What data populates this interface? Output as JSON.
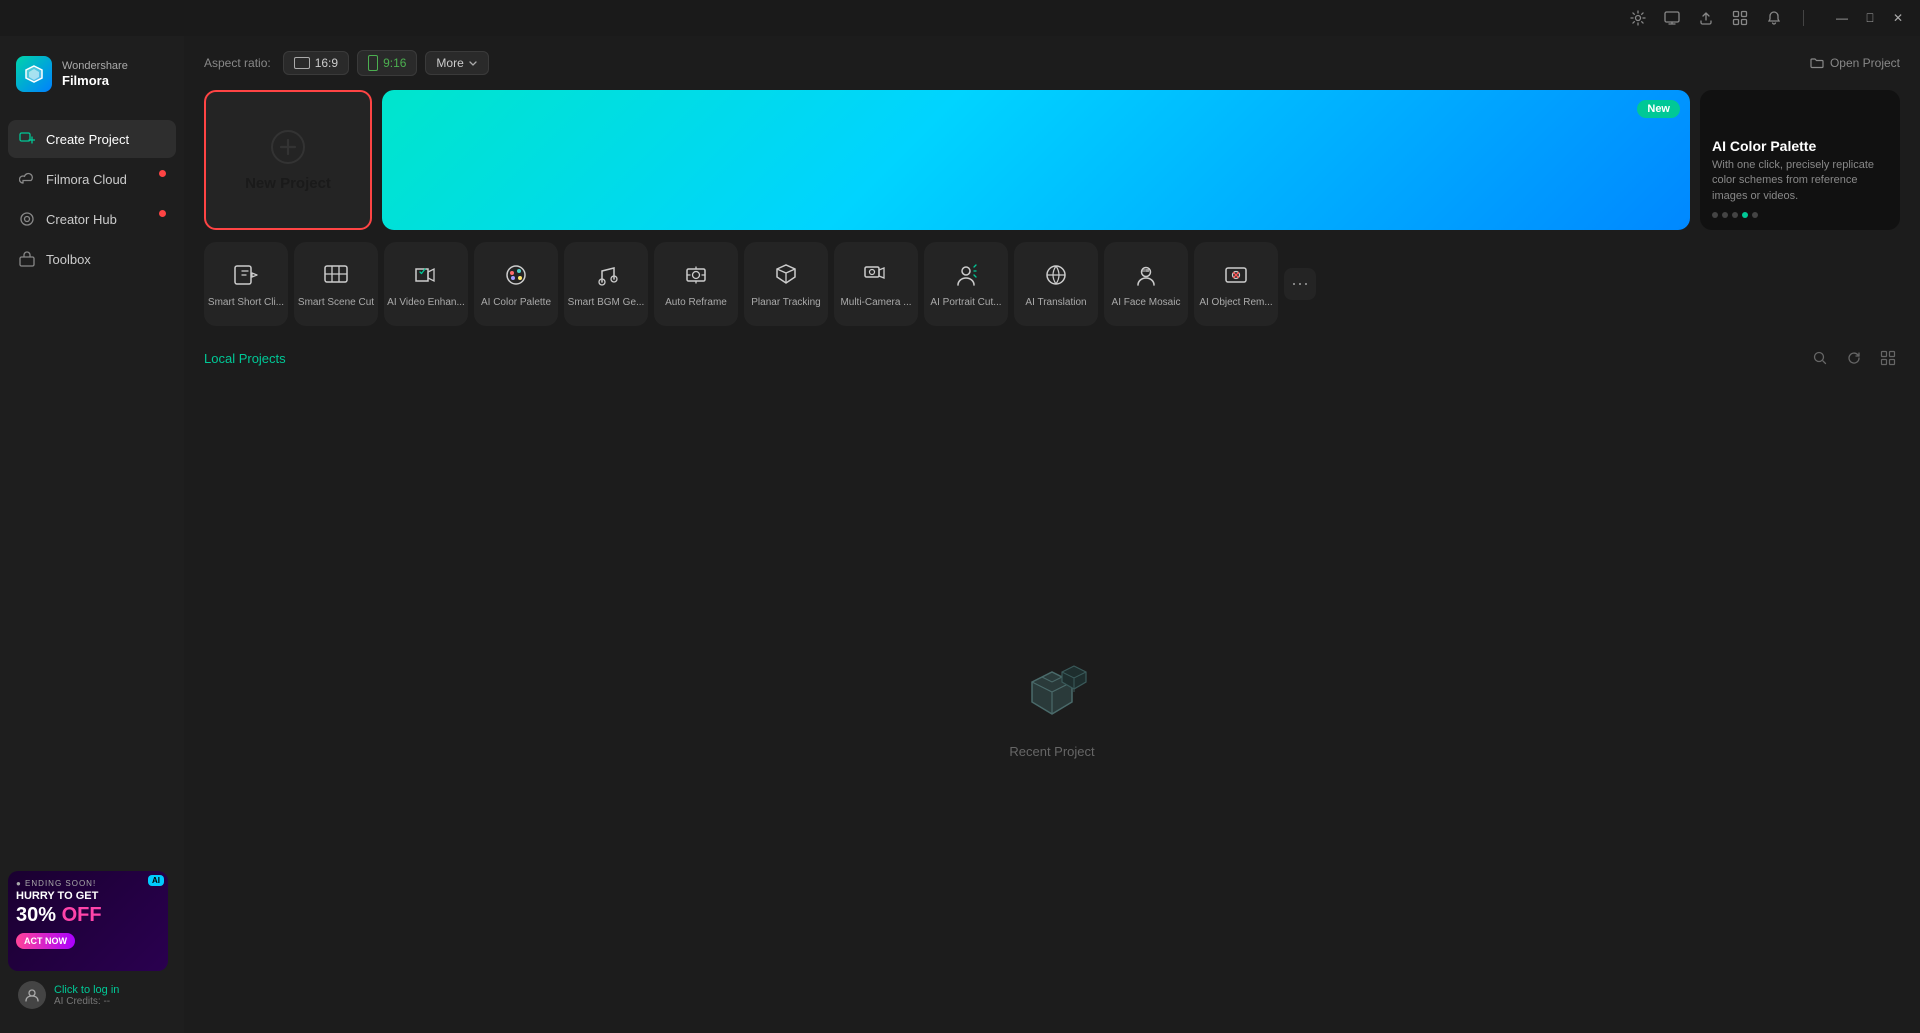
{
  "titlebar": {
    "icons": [
      "settings-icon",
      "monitor-icon",
      "upload-icon",
      "grid-icon",
      "bell-icon"
    ],
    "window_controls": [
      "minimize",
      "maximize",
      "close"
    ]
  },
  "sidebar": {
    "logo": {
      "brand": "Wondershare",
      "product": "Filmora"
    },
    "nav_items": [
      {
        "id": "create-project",
        "label": "Create Project",
        "active": true
      },
      {
        "id": "filmora-cloud",
        "label": "Filmora Cloud",
        "badge": true
      },
      {
        "id": "creator-hub",
        "label": "Creator Hub",
        "badge": true
      },
      {
        "id": "toolbox",
        "label": "Toolbox",
        "badge": false
      }
    ],
    "promo": {
      "ending_label": "● Ending Soon!",
      "ai_badge": "AI",
      "hurry_label": "HURRY TO GET",
      "discount": "30% OFF",
      "cta": "ACT NOW"
    },
    "user": {
      "login_label": "Click to log in",
      "credits_label": "AI Credits: --"
    }
  },
  "aspect_ratio": {
    "label": "Aspect ratio:",
    "options": [
      {
        "id": "16-9",
        "label": "16:9",
        "color": "default"
      },
      {
        "id": "9-16",
        "label": "9:16",
        "color": "green"
      }
    ],
    "more_label": "More",
    "open_project_label": "Open Project"
  },
  "new_project": {
    "label": "New Project"
  },
  "hero_banner": {
    "new_badge": "New"
  },
  "right_panel": {
    "title": "AI Color Palette",
    "description": "With one click, precisely replicate color schemes from reference images or videos.",
    "dots": [
      false,
      false,
      false,
      true,
      false
    ]
  },
  "tools": [
    {
      "id": "smart-short-clip",
      "label": "Smart Short Cli..."
    },
    {
      "id": "smart-scene-cut",
      "label": "Smart Scene Cut"
    },
    {
      "id": "ai-video-enhance",
      "label": "AI Video Enhan..."
    },
    {
      "id": "ai-color-palette",
      "label": "AI Color Palette"
    },
    {
      "id": "smart-bgm",
      "label": "Smart BGM Ge..."
    },
    {
      "id": "auto-reframe",
      "label": "Auto Reframe"
    },
    {
      "id": "planar-tracking",
      "label": "Planar Tracking"
    },
    {
      "id": "multi-camera",
      "label": "Multi-Camera ..."
    },
    {
      "id": "ai-portrait-cut",
      "label": "AI Portrait Cut..."
    },
    {
      "id": "ai-translation",
      "label": "AI Translation"
    },
    {
      "id": "ai-face-mosaic",
      "label": "AI Face Mosaic"
    },
    {
      "id": "ai-object-remove",
      "label": "AI Object Rem..."
    }
  ],
  "local_projects": {
    "title": "Local Projects",
    "actions": [
      "search",
      "refresh",
      "grid-view"
    ]
  },
  "empty_state": {
    "label": "Recent Project"
  }
}
